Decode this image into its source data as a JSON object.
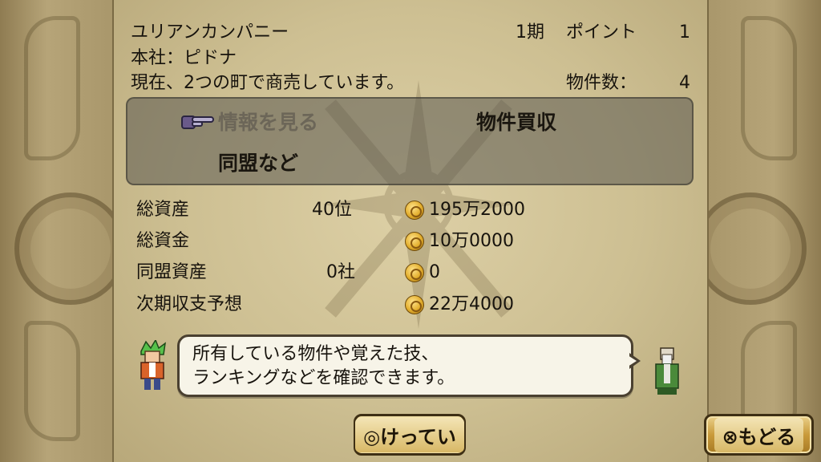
{
  "company": {
    "name": "ユリアンカンパニー",
    "headquarters": "本社：ピドナ",
    "status": "現在、2つの町で商売しています。",
    "period": "1期",
    "points_label": "ポイント",
    "points_value": "1",
    "properties_label": "物件数：",
    "properties_value": "4"
  },
  "menu": {
    "items": [
      {
        "label": "情報を見る"
      },
      {
        "label": "物件買収"
      },
      {
        "label": "同盟など"
      }
    ]
  },
  "stats": [
    {
      "label": "総資産",
      "rank": "40位",
      "value": "195万2000"
    },
    {
      "label": "総資金",
      "rank": "",
      "value": "10万0000"
    },
    {
      "label": "同盟資産",
      "rank": "0社",
      "value": "0"
    },
    {
      "label": "次期収支予想",
      "rank": "",
      "value": "22万4000"
    }
  ],
  "dialog": {
    "line1": "所有している物件や覚えた技、",
    "line2": "ランキングなどを確認できます。"
  },
  "buttons": {
    "confirm": "◎けってい",
    "back": "⊗もどる"
  },
  "icons": {
    "pointer": "hand-pointer-icon",
    "coin": "gold-coin-icon"
  },
  "colors": {
    "parchment": "#cdbf92",
    "button_gold": "#c99a3a",
    "menu_overlay": "#5a5850"
  }
}
